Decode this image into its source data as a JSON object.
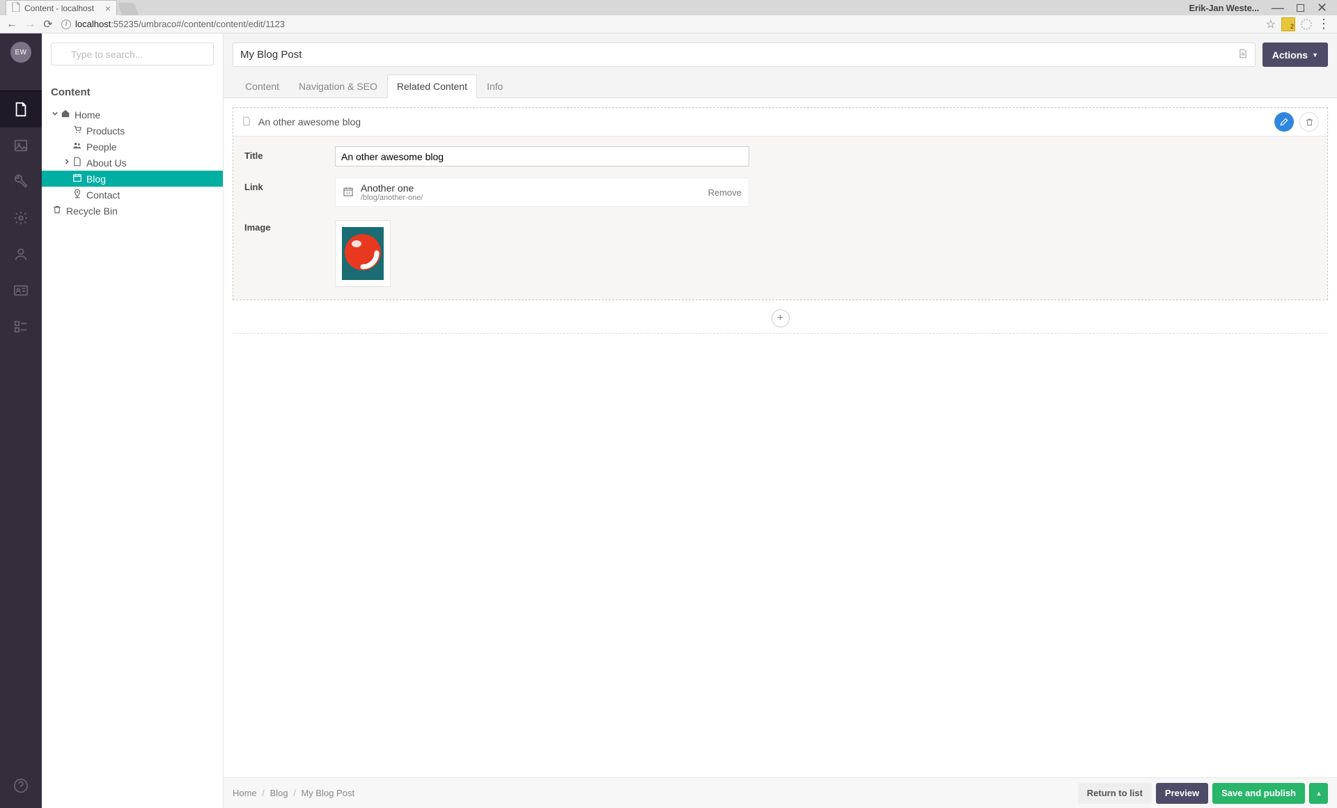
{
  "browser": {
    "tab_title": "Content - localhost",
    "user_label": "Erik-Jan Weste...",
    "url_host": "localhost",
    "url_rest": ":55235/umbraco#/content/content/edit/1123"
  },
  "avatar_initials": "EW",
  "search_placeholder": "Type to search...",
  "sidebar_title": "Content",
  "tree": {
    "home": "Home",
    "products": "Products",
    "people": "People",
    "about": "About Us",
    "blog": "Blog",
    "contact": "Contact",
    "recycle": "Recycle Bin"
  },
  "editor": {
    "doc_title": "My Blog Post",
    "actions_label": "Actions",
    "tabs": {
      "content": "Content",
      "nav": "Navigation & SEO",
      "related": "Related Content",
      "info": "Info"
    },
    "block_title": "An other awesome blog",
    "fields": {
      "title_label": "Title",
      "link_label": "Link",
      "image_label": "Image"
    },
    "title_value": "An other awesome blog",
    "link_name": "Another one",
    "link_path": "/blog/another-one/",
    "link_remove": "Remove"
  },
  "footer": {
    "crumb_home": "Home",
    "crumb_blog": "Blog",
    "crumb_current": "My Blog Post",
    "return": "Return to list",
    "preview": "Preview",
    "save": "Save and publish"
  }
}
